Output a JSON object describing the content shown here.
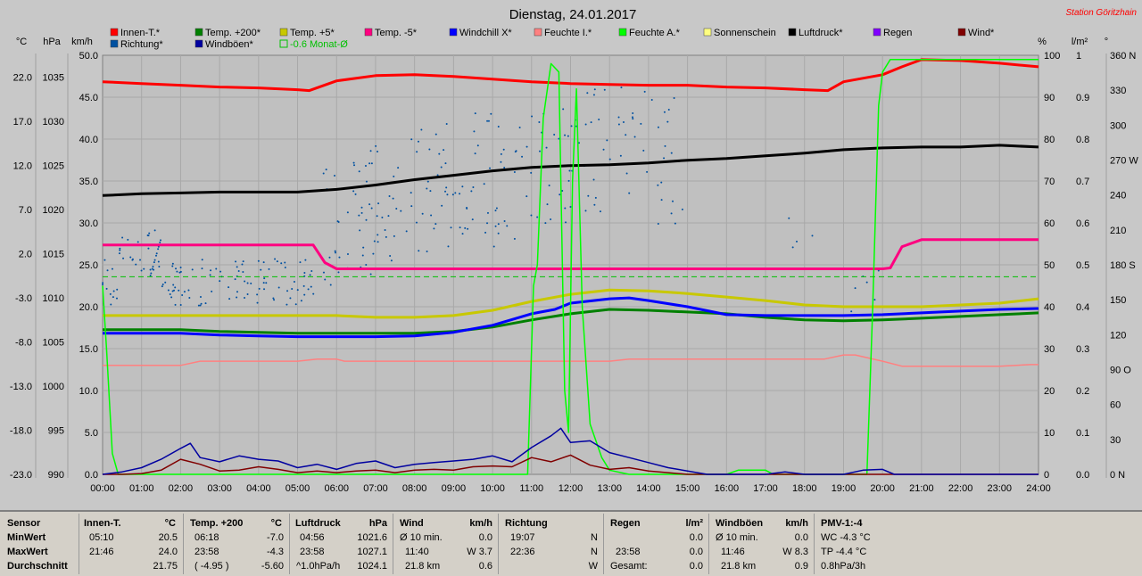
{
  "title": "Dienstag, 24.01.2017",
  "station": "Station Göritzhain",
  "unit_labels": {
    "temp": "°C",
    "press": "hPa",
    "wind": "km/h",
    "pct": "%",
    "rad": "l/m²",
    "deg": "°"
  },
  "legend": [
    {
      "label": "Innen-T.*",
      "color": "#ff0000"
    },
    {
      "label": "Temp. +200*",
      "color": "#008000"
    },
    {
      "label": "Temp. +5*",
      "color": "#c8c800"
    },
    {
      "label": "Temp. -5*",
      "color": "#ff0080"
    },
    {
      "label": "Windchill X*",
      "color": "#0000ff"
    },
    {
      "label": "Feuchte I.*",
      "color": "#ff8080"
    },
    {
      "label": "Feuchte A.*",
      "color": "#00ff00"
    },
    {
      "label": "Sonnenschein",
      "color": "#ffff80"
    },
    {
      "label": "Luftdruck*",
      "color": "#000000"
    },
    {
      "label": "Regen",
      "color": "#8000ff"
    },
    {
      "label": "Wind*",
      "color": "#800000"
    },
    {
      "label": "Richtung*",
      "color": "#0050a0"
    },
    {
      "label": "Windböen*",
      "color": "#0000a0"
    },
    {
      "label": "-0.6 Monat-Ø",
      "color": "#00c000"
    }
  ],
  "chart_data": {
    "type": "line",
    "title": "Dienstag, 24.01.2017",
    "x_ticks": [
      "00:00",
      "01:00",
      "02:00",
      "03:00",
      "04:00",
      "05:00",
      "06:00",
      "07:00",
      "08:00",
      "09:00",
      "10:00",
      "11:00",
      "12:00",
      "13:00",
      "14:00",
      "15:00",
      "16:00",
      "17:00",
      "18:00",
      "19:00",
      "20:00",
      "21:00",
      "22:00",
      "23:00",
      "24:00"
    ],
    "axes": {
      "temp_c": {
        "ticks": [
          "22.0",
          "17.0",
          "12.0",
          "7.0",
          "2.0",
          "-3.0",
          "-8.0",
          "-13.0",
          "-18.0",
          "-23.0"
        ],
        "ylim": [
          -23,
          24.5
        ]
      },
      "press_hpa": {
        "ticks": [
          "1035",
          "1030",
          "1025",
          "1020",
          "1015",
          "1010",
          "1005",
          "1000",
          "995",
          "990"
        ],
        "ylim": [
          990,
          1037.5
        ]
      },
      "wind_kmh": {
        "ticks": [
          "50.0",
          "45.0",
          "40.0",
          "35.0",
          "30.0",
          "25.0",
          "20.0",
          "15.0",
          "10.0",
          "5.0",
          "0.0"
        ],
        "ylim": [
          0,
          50
        ]
      },
      "humidity_pct": {
        "ticks": [
          "100",
          "90",
          "80",
          "70",
          "60",
          "50",
          "40",
          "30",
          "20",
          "10",
          "0"
        ],
        "ylim": [
          0,
          100
        ]
      },
      "rain_lm2": {
        "ticks": [
          "1",
          "0.9",
          "0.8",
          "0.7",
          "0.6",
          "0.5",
          "0.4",
          "0.3",
          "0.2",
          "0.1",
          "0.0"
        ],
        "ylim": [
          0,
          1
        ]
      },
      "direction_deg": {
        "ticks": [
          "360 N",
          "330",
          "300",
          "270 W",
          "240",
          "210",
          "180 S",
          "150",
          "120",
          "90 O",
          "60",
          "30",
          "0 N"
        ],
        "ylim": [
          0,
          360
        ]
      }
    },
    "grid": true,
    "legend_placement": "top",
    "series": [
      {
        "name": "Innen-T.*",
        "axis": "temp_c",
        "color": "#ff0000",
        "x": [
          0,
          1,
          2,
          3,
          4,
          5,
          5.3,
          6,
          7,
          8,
          9,
          10,
          11,
          12,
          13,
          14,
          15,
          16,
          17,
          18,
          18.6,
          19,
          20,
          20.5,
          21,
          22,
          23,
          24
        ],
        "y": [
          21.5,
          21.3,
          21.1,
          20.9,
          20.8,
          20.6,
          20.5,
          21.6,
          22.2,
          22.3,
          22.1,
          21.8,
          21.5,
          21.3,
          21.2,
          21.1,
          21.1,
          20.9,
          20.8,
          20.6,
          20.5,
          21.5,
          22.3,
          23.2,
          24.0,
          23.9,
          23.6,
          23.2
        ]
      },
      {
        "name": "Luftdruck*",
        "axis": "press_hpa",
        "color": "#000000",
        "x": [
          0,
          1,
          2,
          3,
          4,
          5,
          6,
          7,
          8,
          9,
          10,
          11,
          12,
          13,
          14,
          15,
          16,
          17,
          18,
          19,
          20,
          21,
          22,
          23,
          24
        ],
        "y": [
          1021.6,
          1021.8,
          1021.9,
          1022.0,
          1022.0,
          1022.0,
          1022.3,
          1022.8,
          1023.4,
          1023.9,
          1024.4,
          1024.8,
          1025.0,
          1025.1,
          1025.3,
          1025.6,
          1025.8,
          1026.1,
          1026.4,
          1026.8,
          1027.0,
          1027.1,
          1027.1,
          1027.3,
          1027.1
        ]
      },
      {
        "name": "Temp. -5*",
        "axis": "temp_c",
        "color": "#ff0080",
        "x": [
          0,
          1,
          2,
          3,
          4,
          5,
          5.4,
          5.7,
          6,
          7,
          8,
          9,
          10,
          11,
          12,
          13,
          14,
          15,
          16,
          17,
          18,
          19,
          20,
          20.2,
          20.5,
          21,
          22,
          23,
          24
        ],
        "y": [
          3.0,
          3.0,
          3.0,
          3.0,
          3.0,
          3.0,
          3.0,
          1.0,
          0.3,
          0.3,
          0.3,
          0.3,
          0.3,
          0.3,
          0.3,
          0.3,
          0.3,
          0.3,
          0.3,
          0.3,
          0.3,
          0.3,
          0.3,
          0.4,
          2.8,
          3.6,
          3.6,
          3.6,
          3.6
        ]
      },
      {
        "name": "Temp. +5*",
        "axis": "temp_c",
        "color": "#c8c800",
        "x": [
          0,
          1,
          2,
          3,
          4,
          5,
          6,
          7,
          8,
          9,
          10,
          11,
          12,
          13,
          14,
          15,
          16,
          17,
          18,
          19,
          20,
          21,
          22,
          23,
          24
        ],
        "y": [
          -5.0,
          -5.0,
          -5.0,
          -5.0,
          -5.0,
          -5.0,
          -5.0,
          -5.2,
          -5.2,
          -5.0,
          -4.4,
          -3.4,
          -2.6,
          -2.1,
          -2.2,
          -2.5,
          -2.9,
          -3.3,
          -3.8,
          -4.0,
          -4.0,
          -4.0,
          -3.8,
          -3.6,
          -3.1
        ]
      },
      {
        "name": "Temp. +200*",
        "axis": "temp_c",
        "color": "#008000",
        "x": [
          0,
          1,
          2,
          3,
          4,
          5,
          6,
          7,
          8,
          9,
          10,
          11,
          12,
          13,
          14,
          15,
          16,
          17,
          18,
          19,
          20,
          21,
          22,
          23,
          24
        ],
        "y": [
          -6.6,
          -6.6,
          -6.6,
          -6.8,
          -6.9,
          -7.0,
          -7.0,
          -7.0,
          -7.0,
          -6.8,
          -6.3,
          -5.5,
          -4.8,
          -4.3,
          -4.4,
          -4.6,
          -4.8,
          -5.2,
          -5.5,
          -5.6,
          -5.5,
          -5.3,
          -5.1,
          -4.9,
          -4.7
        ]
      },
      {
        "name": "Windchill X*",
        "axis": "temp_c",
        "color": "#0000ff",
        "x": [
          0,
          1,
          2,
          3,
          4,
          5,
          6,
          7,
          8,
          9,
          10,
          11,
          11.6,
          12,
          13,
          13.5,
          14,
          15,
          16,
          17,
          18,
          19,
          20,
          21,
          22,
          23,
          24
        ],
        "y": [
          -7.0,
          -7.0,
          -7.0,
          -7.2,
          -7.3,
          -7.4,
          -7.4,
          -7.4,
          -7.3,
          -6.9,
          -6.1,
          -4.8,
          -4.3,
          -3.6,
          -3.1,
          -3.0,
          -3.3,
          -4.0,
          -4.9,
          -5.0,
          -5.0,
          -5.0,
          -4.9,
          -4.7,
          -4.5,
          -4.3,
          -4.2
        ]
      },
      {
        "name": "Feuchte I.*",
        "axis": "humidity_pct",
        "color": "#ff8080",
        "x": [
          0,
          1,
          2,
          2.5,
          3,
          4,
          5,
          5.5,
          6,
          6.2,
          7,
          8,
          9,
          10,
          11,
          12,
          13,
          13.5,
          14,
          15,
          16,
          17,
          18,
          18.5,
          19,
          19.3,
          20,
          20.5,
          21,
          22,
          23,
          23.8,
          24
        ],
        "y": [
          26,
          26,
          26,
          27,
          27,
          27,
          27,
          27.5,
          27.5,
          27,
          27,
          27,
          27,
          27,
          27,
          27,
          27,
          27.5,
          27.5,
          27.5,
          27.5,
          27.5,
          27.5,
          27.5,
          28.5,
          28.5,
          27,
          25.8,
          25.8,
          25.8,
          25.8,
          26.2,
          26.2
        ]
      },
      {
        "name": "Feuchte A.*",
        "axis": "humidity_pct",
        "color": "#00ff00",
        "x": [
          0,
          0.1,
          0.25,
          0.4,
          1,
          2,
          3,
          4,
          5,
          6,
          7,
          8,
          9,
          10,
          10.9,
          11.05,
          11.15,
          11.3,
          11.5,
          11.7,
          11.85,
          11.95,
          12.05,
          12.15,
          12.3,
          12.5,
          12.8,
          13,
          13.5,
          14,
          15,
          16,
          16.3,
          17,
          17.2,
          18,
          19,
          19.4,
          19.6,
          19.75,
          19.9,
          20,
          20.2,
          21,
          22,
          23,
          24
        ],
        "y": [
          45,
          30,
          5,
          0,
          0,
          0,
          0,
          0,
          0,
          0,
          0,
          0,
          0,
          0,
          0,
          45,
          50,
          85,
          98,
          96,
          20,
          10,
          70,
          92,
          40,
          12,
          4,
          1,
          0,
          0,
          0,
          0,
          1,
          1,
          0,
          0,
          0,
          0,
          0,
          40,
          88,
          96,
          99,
          99,
          99,
          99,
          99
        ]
      },
      {
        "name": "Wind*",
        "axis": "wind_kmh",
        "color": "#800000",
        "x": [
          0,
          0.5,
          1,
          1.5,
          2,
          2.5,
          3,
          3.5,
          4,
          4.5,
          5,
          5.5,
          6,
          6.5,
          7,
          7.5,
          8,
          8.5,
          9,
          9.5,
          10,
          10.5,
          11,
          11.5,
          12,
          12.5,
          13,
          13.5,
          14,
          14.5,
          15,
          15.5,
          16,
          17,
          18,
          19,
          20,
          21,
          22,
          23,
          24
        ],
        "y": [
          0,
          0,
          0.1,
          0.5,
          1.8,
          1.2,
          0.4,
          0.5,
          0.9,
          0.6,
          0.2,
          0.4,
          0.2,
          0.4,
          0.5,
          0.2,
          0.5,
          0.6,
          0.5,
          0.9,
          1.0,
          0.9,
          2.0,
          1.5,
          2.3,
          1.1,
          0.6,
          0.8,
          0.4,
          0.2,
          0,
          0,
          0,
          0,
          0,
          0,
          0,
          0,
          0,
          0,
          0
        ]
      },
      {
        "name": "Windböen*",
        "axis": "wind_kmh",
        "color": "#0000a0",
        "x": [
          0,
          0.5,
          1,
          1.5,
          2,
          2.25,
          2.5,
          3,
          3.5,
          4,
          4.5,
          5,
          5.5,
          6,
          6.5,
          7,
          7.5,
          8,
          8.5,
          9,
          9.5,
          10,
          10.5,
          11,
          11.5,
          11.75,
          12,
          12.5,
          13,
          13.5,
          14,
          14.5,
          15,
          15.5,
          16,
          17,
          17.5,
          18,
          19,
          19.5,
          20,
          20.3,
          21,
          22,
          23,
          24
        ],
        "y": [
          0,
          0.3,
          0.8,
          1.8,
          3.1,
          3.7,
          2.0,
          1.5,
          2.2,
          1.8,
          1.6,
          0.8,
          1.2,
          0.6,
          1.3,
          1.6,
          0.8,
          1.2,
          1.4,
          1.6,
          1.8,
          2.2,
          1.5,
          3.2,
          4.6,
          5.5,
          3.8,
          4.0,
          2.6,
          2.0,
          1.4,
          0.8,
          0.4,
          0,
          0,
          0,
          0.3,
          0,
          0,
          0.5,
          0.6,
          0,
          0,
          0,
          0,
          0
        ]
      },
      {
        "name": "-0.6 Monat-Ø",
        "axis": "temp_c",
        "color": "#00c000",
        "dashed": true,
        "x": [
          0,
          24
        ],
        "y": [
          -0.6,
          -0.6
        ]
      },
      {
        "name": "Richtung*",
        "axis": "direction_deg",
        "type": "scatter",
        "color": "#0050a0"
      }
    ]
  },
  "stats": {
    "sensor": {
      "header": "Sensor",
      "rows": [
        "MinWert",
        "MaxWert",
        "Durchschnitt"
      ]
    },
    "innen": {
      "header": "Innen-T.",
      "unit": "°C",
      "rows": [
        [
          "05:10",
          "20.5"
        ],
        [
          "21:46",
          "24.0"
        ],
        [
          "",
          "21.75"
        ]
      ]
    },
    "temp200": {
      "header": "Temp. +200",
      "unit": "°C",
      "rows": [
        [
          "06:18",
          "-7.0"
        ],
        [
          "23:58",
          "-4.3"
        ],
        [
          "( -4.95 )",
          "-5.60"
        ]
      ]
    },
    "luftdruck": {
      "header": "Luftdruck",
      "unit": "hPa",
      "rows": [
        [
          "04:56",
          "1021.6"
        ],
        [
          "23:58",
          "1027.1"
        ],
        [
          "^1.0hPa/h",
          "1024.1"
        ]
      ]
    },
    "wind": {
      "header": "Wind",
      "unit": "km/h",
      "rows": [
        [
          "Ø 10 min.",
          "0.0"
        ],
        [
          "11:40",
          "W 3.7"
        ],
        [
          "21.8 km",
          "0.6"
        ]
      ]
    },
    "richtung": {
      "header": "Richtung",
      "rows": [
        [
          "19:07",
          "N"
        ],
        [
          "22:36",
          "N"
        ],
        [
          "",
          "W"
        ]
      ]
    },
    "regen": {
      "header": "Regen",
      "unit": "l/m²",
      "rows": [
        [
          "",
          "0.0"
        ],
        [
          "23:58",
          "0.0"
        ],
        [
          "Gesamt:",
          "0.0"
        ]
      ]
    },
    "windboeen": {
      "header": "Windböen",
      "unit": "km/h",
      "rows": [
        [
          "Ø 10 min.",
          "0.0"
        ],
        [
          "11:46",
          "W 8.3"
        ],
        [
          "21.8 km",
          "0.9"
        ]
      ]
    },
    "pmv": {
      "header": "PMV-1:-4",
      "rows": [
        "WC -4.3 °C",
        "TP -4.4 °C",
        "0.8hPa/3h"
      ]
    }
  }
}
